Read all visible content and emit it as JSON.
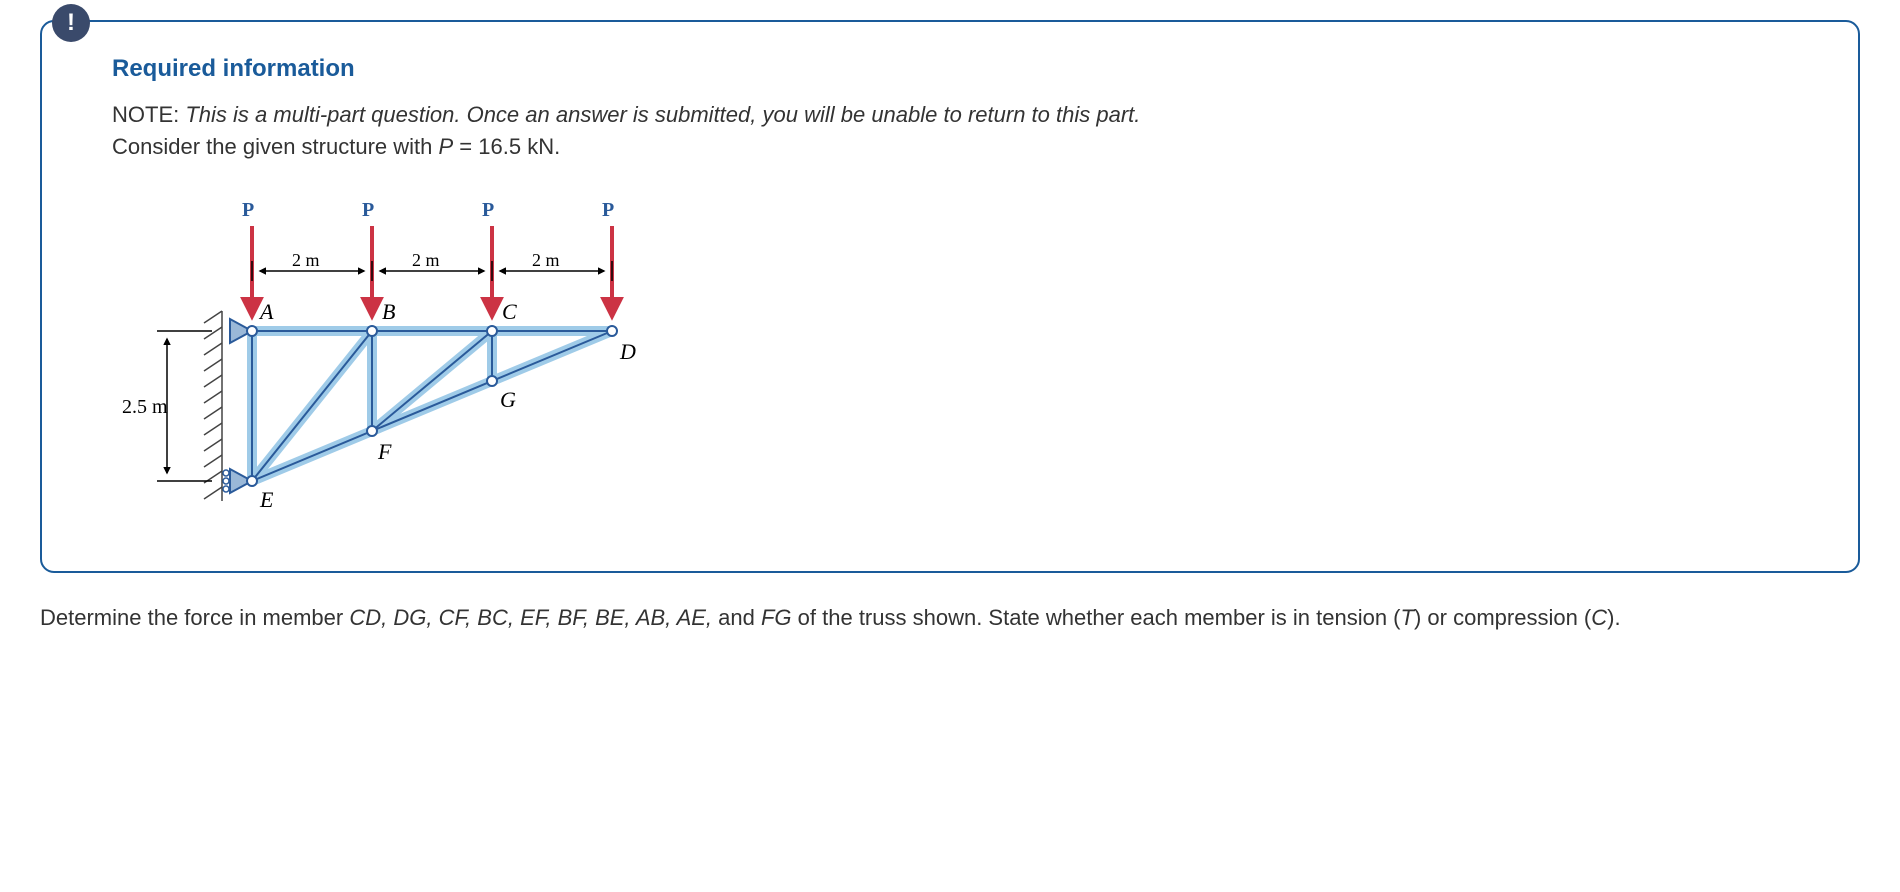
{
  "badge": "!",
  "heading": "Required information",
  "note_prefix": "NOTE:",
  "note_body": "This is a multi-part question. Once an answer is submitted, you will be unable to return to this part.",
  "consider_pre": "Consider the given structure with ",
  "consider_var": "P",
  "consider_post": " = 16.5 kN.",
  "diagram": {
    "P": "P",
    "dim2m": "2 m",
    "dim25m": "2.5 m",
    "A": "A",
    "B": "B",
    "C": "C",
    "D": "D",
    "E": "E",
    "F": "F",
    "G": "G"
  },
  "question_pre": "Determine the force in member ",
  "members": "CD, DG, CF, BC, EF, BF, BE, AB, AE,",
  "and": " and ",
  "member_last": "FG",
  "question_mid": " of the truss shown. State whether each member is in tension (",
  "t_label": "T",
  "question_or": ") or compression (",
  "c_label": "C",
  "question_end": ")."
}
